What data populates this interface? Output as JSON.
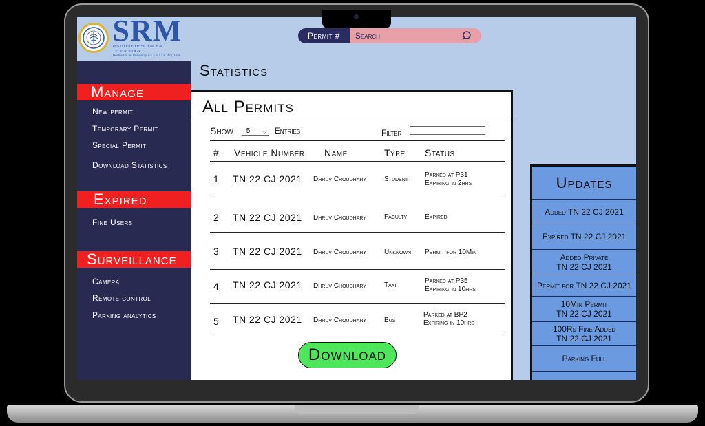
{
  "header": {
    "logo_word": "SRM",
    "logo_sub1": "INSTITUTE OF SCIENCE & TECHNOLOGY",
    "logo_sub2": "Deemed to be University u/s 3 of UGC Act, 1956",
    "permit_label": "Permit #",
    "search_placeholder": "Search"
  },
  "sidebar": {
    "manage": {
      "heading": "Manage",
      "items": [
        "New permit",
        "Temporary Permit",
        "Special Permit",
        "Download Statistics"
      ]
    },
    "expired": {
      "heading": "Expired",
      "items": [
        "Fine Users"
      ]
    },
    "surveillance": {
      "heading": "Surveillance",
      "items": [
        "Camera",
        "Remote control",
        "Parking analytics"
      ]
    }
  },
  "main": {
    "page_title": "Statistics",
    "panel_title": "All Permits",
    "show_label": "Show",
    "show_value": "5",
    "entries_label": "Entries",
    "filter_label": "Filter",
    "columns": [
      "#",
      "Vehicle Number",
      "Name",
      "Type",
      "Status"
    ],
    "rows": [
      {
        "num": "1",
        "vehicle": "TN 22 CJ 2021",
        "name": "Dhruv Choudhary",
        "type": "Student",
        "status1": "Parked at P31",
        "status2": "Expiring in 2hrs"
      },
      {
        "num": "2",
        "vehicle": "TN 22 CJ 2021",
        "name": "Dhruv Choudhary",
        "type": "Faculty",
        "status1": "Expired",
        "status2": ""
      },
      {
        "num": "3",
        "vehicle": "TN 22 CJ 2021",
        "name": "Dhruv Choudhary",
        "type": "Unknown",
        "status1": "Permit for 10Min",
        "status2": ""
      },
      {
        "num": "4",
        "vehicle": "TN 22 CJ 2021",
        "name": "Dhruv Choudhary",
        "type": "Taxi",
        "status1": "Parked at P35",
        "status2": "Expiring in 10hrs"
      },
      {
        "num": "5",
        "vehicle": "TN 22 CJ 2021",
        "name": "Dhruv Choudhary",
        "type": "Bus",
        "status1": "Parked at BP2",
        "status2": "Expiring in 10hrs"
      }
    ],
    "download_label": "Download"
  },
  "updates": {
    "title": "Updates",
    "items": [
      {
        "line1": "Added TN 22 CJ 2021",
        "line2": ""
      },
      {
        "line1": "Expired TN 22 CJ 2021",
        "line2": ""
      },
      {
        "line1": "Added Private",
        "line2": "TN 22 CJ 2021"
      },
      {
        "line1": "Permit for TN 22 CJ 2021",
        "line2": ""
      },
      {
        "line1": "10Min Permit",
        "line2": "TN 22 CJ 2021"
      },
      {
        "line1": "100Rs Fine Added",
        "line2": "TN 22 CJ 2021"
      },
      {
        "line1": "Parking Full",
        "line2": ""
      }
    ]
  },
  "colors": {
    "sidebar_bg": "#292a52",
    "section_red": "#f02020",
    "screen_bg": "#b6cce8",
    "updates_bg": "#6c9ae0",
    "download_green": "#4ee65a",
    "search_pink": "#e8a0a8"
  }
}
